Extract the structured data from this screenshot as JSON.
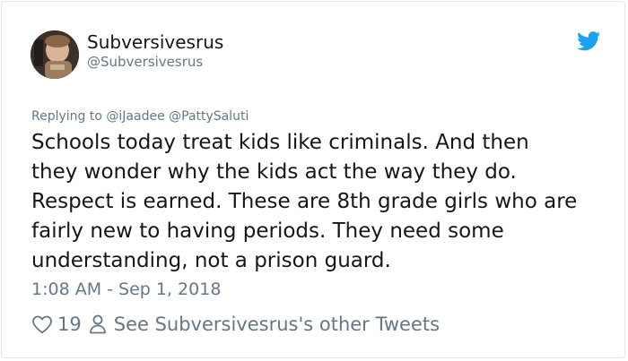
{
  "tweet": {
    "display_name": "Subversivesrus",
    "handle": "@Subversivesrus",
    "replying_prefix": "Replying to",
    "reply_mentions": [
      "@iJaadee",
      "@PattySaluti"
    ],
    "text_lines": [
      "Schools today treat kids like criminals. And then",
      "they wonder why the kids act the way they do.",
      "Respect is earned. These are 8th grade girls who are",
      "fairly new to having periods. They need some",
      "understanding, not a prison guard."
    ],
    "timestamp": "1:08 AM - Sep 1, 2018",
    "like_count": "19",
    "other_tweets_label": "See Subversivesrus's other Tweets"
  },
  "icons": {
    "brand": "twitter-bird-icon",
    "like": "heart-icon",
    "profile": "person-icon"
  },
  "colors": {
    "brand_blue": "#1da1f2",
    "text": "#14171a",
    "secondary": "#657786",
    "border": "#e1e8ed"
  }
}
